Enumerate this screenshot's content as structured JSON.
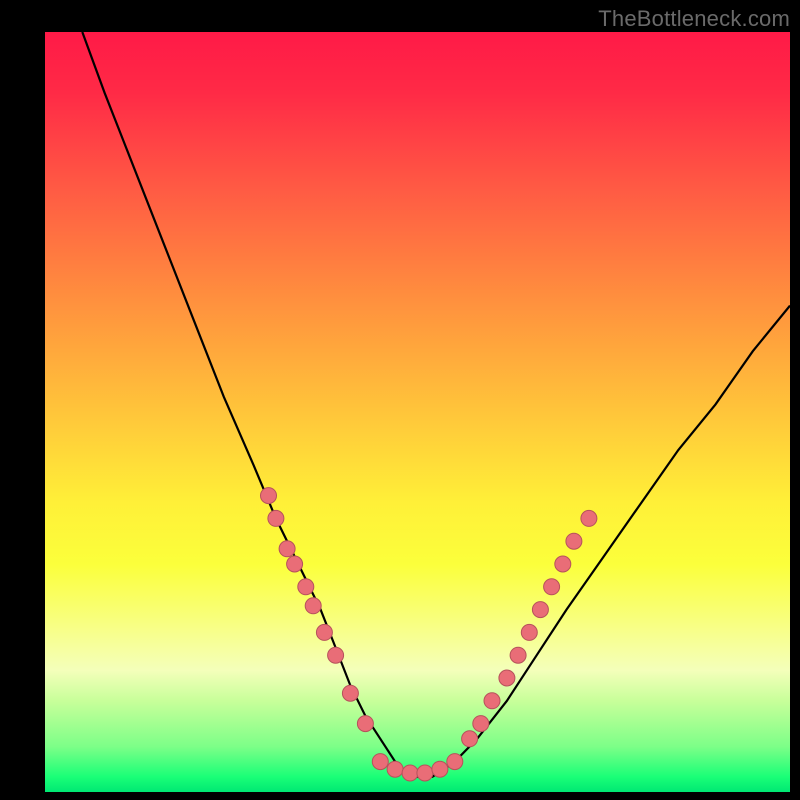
{
  "watermark": "TheBottleneck.com",
  "chart_data": {
    "type": "line",
    "title": "",
    "xlabel": "",
    "ylabel": "",
    "xlim": [
      0,
      100
    ],
    "ylim": [
      0,
      100
    ],
    "background": {
      "type": "vertical_gradient",
      "stops": [
        {
          "offset": 0.0,
          "color": "#ff1a47"
        },
        {
          "offset": 0.08,
          "color": "#ff2a46"
        },
        {
          "offset": 0.2,
          "color": "#ff5844"
        },
        {
          "offset": 0.35,
          "color": "#ff8f3e"
        },
        {
          "offset": 0.5,
          "color": "#ffc53a"
        },
        {
          "offset": 0.62,
          "color": "#fff038"
        },
        {
          "offset": 0.7,
          "color": "#fbff3b"
        },
        {
          "offset": 0.78,
          "color": "#f8ff83"
        },
        {
          "offset": 0.84,
          "color": "#f4ffba"
        },
        {
          "offset": 0.88,
          "color": "#c8ff9a"
        },
        {
          "offset": 0.94,
          "color": "#7dff88"
        },
        {
          "offset": 0.98,
          "color": "#1aff77"
        },
        {
          "offset": 1.0,
          "color": "#00e873"
        }
      ]
    },
    "series": [
      {
        "name": "bottleneck-curve",
        "color": "#000000",
        "x": [
          5,
          8,
          12,
          16,
          20,
          24,
          28,
          31,
          34,
          37,
          39,
          41,
          43,
          45,
          47,
          49,
          52,
          55,
          58,
          62,
          66,
          70,
          75,
          80,
          85,
          90,
          95,
          100
        ],
        "y": [
          100,
          92,
          82,
          72,
          62,
          52,
          43,
          36,
          30,
          24,
          19,
          14,
          10,
          7,
          4,
          2,
          2,
          4,
          7,
          12,
          18,
          24,
          31,
          38,
          45,
          51,
          58,
          64
        ]
      }
    ],
    "markers": [
      {
        "name": "left-cluster",
        "color": "#e96d77",
        "stroke": "#b6525b",
        "points": [
          {
            "x": 30,
            "y": 39
          },
          {
            "x": 31,
            "y": 36
          },
          {
            "x": 32.5,
            "y": 32
          },
          {
            "x": 33.5,
            "y": 30
          },
          {
            "x": 35,
            "y": 27
          },
          {
            "x": 36,
            "y": 24.5
          },
          {
            "x": 37.5,
            "y": 21
          },
          {
            "x": 39,
            "y": 18
          },
          {
            "x": 41,
            "y": 13
          },
          {
            "x": 43,
            "y": 9
          }
        ]
      },
      {
        "name": "bottom-cluster",
        "color": "#e96d77",
        "stroke": "#b6525b",
        "points": [
          {
            "x": 45,
            "y": 4
          },
          {
            "x": 47,
            "y": 3
          },
          {
            "x": 49,
            "y": 2.5
          },
          {
            "x": 51,
            "y": 2.5
          },
          {
            "x": 53,
            "y": 3
          },
          {
            "x": 55,
            "y": 4
          }
        ]
      },
      {
        "name": "right-cluster",
        "color": "#e96d77",
        "stroke": "#b6525b",
        "points": [
          {
            "x": 57,
            "y": 7
          },
          {
            "x": 58.5,
            "y": 9
          },
          {
            "x": 60,
            "y": 12
          },
          {
            "x": 62,
            "y": 15
          },
          {
            "x": 63.5,
            "y": 18
          },
          {
            "x": 65,
            "y": 21
          },
          {
            "x": 66.5,
            "y": 24
          },
          {
            "x": 68,
            "y": 27
          },
          {
            "x": 69.5,
            "y": 30
          },
          {
            "x": 71,
            "y": 33
          },
          {
            "x": 73,
            "y": 36
          }
        ]
      }
    ]
  }
}
